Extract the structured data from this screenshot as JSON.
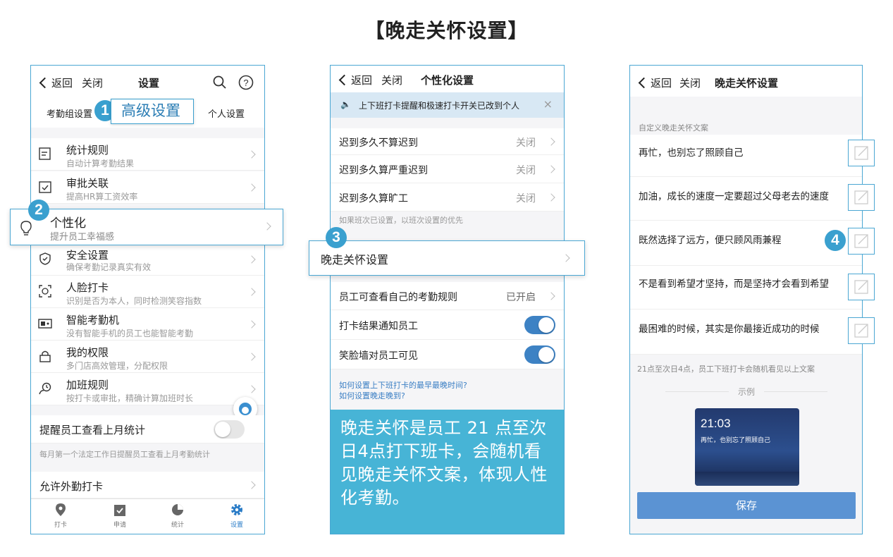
{
  "page_title": "【晚走关怀设置】",
  "colors": {
    "accent": "#3aa0cf",
    "toggle_on": "#3d82c4",
    "save_button": "#5b93d3"
  },
  "phone1": {
    "nav": {
      "back": "返回",
      "close": "关闭",
      "title": "设置"
    },
    "tabs": {
      "group": "考勤组设置",
      "advanced": "高级设置",
      "personal": "个人设置"
    },
    "items": [
      {
        "title": "统计规则",
        "sub": "自动计算考勤结果",
        "icon": "edit-list-icon"
      },
      {
        "title": "审批关联",
        "sub": "提高HR算工资效率",
        "icon": "calendar-check-icon"
      },
      {
        "title": "个性化",
        "sub": "提升员工幸福感",
        "icon": "lightbulb-icon"
      },
      {
        "title": "安全设置",
        "sub": "确保考勤记录真实有效",
        "icon": "shield-icon"
      },
      {
        "title": "人脸打卡",
        "sub": "识别是否为本人，同时检测笑容指数",
        "icon": "face-scan-icon"
      },
      {
        "title": "智能考勤机",
        "sub": "没有智能手机的员工也能智能考勤",
        "icon": "device-icon"
      },
      {
        "title": "我的权限",
        "sub": "多门店高效管理，分配权限",
        "icon": "lock-icon"
      },
      {
        "title": "加班规则",
        "sub": "按打卡或审批，精确计算加班时长",
        "icon": "overtime-icon"
      }
    ],
    "remind_label": "提醒员工查看上月统计",
    "remind_note": "每月第一个法定工作日提醒员工查看上月考勤统计",
    "outside_label": "允许外勤打卡",
    "tabbar": [
      "打卡",
      "申请",
      "统计",
      "设置"
    ],
    "badges": [
      "1",
      "2"
    ]
  },
  "phone2": {
    "nav": {
      "back": "返回",
      "close": "关闭",
      "title": "个性化设置"
    },
    "notice": "上下班打卡提醒和极速打卡开关已改到个人",
    "rows": [
      {
        "label": "迟到多久不算迟到",
        "value": "关闭"
      },
      {
        "label": "迟到多久算严重迟到",
        "value": "关闭"
      },
      {
        "label": "迟到多久算旷工",
        "value": "关闭"
      }
    ],
    "shift_note": "如果班次已设置，以班次设置的优先",
    "late_care": "晚走关怀设置",
    "view_rules": {
      "label": "员工可查看自己的考勤规则",
      "value": "已开启"
    },
    "notify_label": "打卡结果通知员工",
    "smile_label": "笑脸墙对员工可见",
    "links": [
      "如何设置上下班打卡的最早最晚时间?",
      "如何设置晚走晚到?"
    ],
    "info": "晚走关怀是员工 21 点至次日4点打下班卡，会随机看见晚走关怀文案，体现人性化考勤。",
    "badge": "3"
  },
  "phone3": {
    "nav": {
      "back": "返回",
      "close": "关闭",
      "title": "晚走关怀设置"
    },
    "section_label": "自定义晚走关怀文案",
    "messages": [
      "再忙，也别忘了照顾自己",
      "加油，成长的速度一定要超过父母老去的速度",
      "既然选择了远方，便只顾风雨兼程",
      "不是看到希望才坚持，而是坚持才会看到希望",
      "最困难的时候，其实是你最接近成功的时候"
    ],
    "footnote": "21点至次日4点，员工下班打卡会随机看见以上文案",
    "example_label": "示例",
    "example_time": "21:03",
    "example_text": "再忙，也别忘了照顾自己",
    "save": "保存",
    "badge": "4"
  }
}
